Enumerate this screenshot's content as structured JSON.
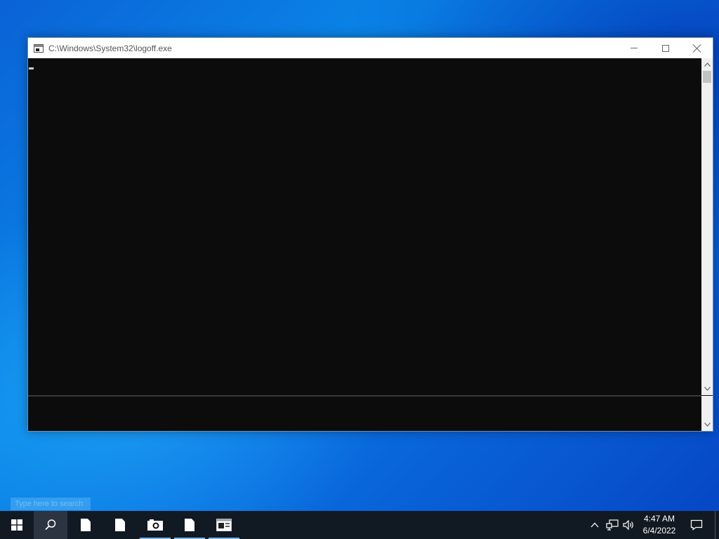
{
  "window": {
    "title": "C:\\Windows\\System32\\logoff.exe",
    "icon": "console-window-icon",
    "minimize_icon": "minimize-icon",
    "maximize_icon": "maximize-icon",
    "close_icon": "close-icon",
    "console_background": "#0c0c0c"
  },
  "desktop": {
    "search_hint": "Type here to search"
  },
  "taskbar": {
    "background": "#111923",
    "accent": "#79b6ea",
    "items": [
      {
        "name": "start-button",
        "icon": "windows-logo-icon"
      },
      {
        "name": "search-button",
        "icon": "search-icon"
      },
      {
        "name": "taskbar-app-1",
        "icon": "document-icon"
      },
      {
        "name": "taskbar-app-2",
        "icon": "document-icon"
      },
      {
        "name": "taskbar-app-3",
        "icon": "camera-icon"
      },
      {
        "name": "taskbar-app-4",
        "icon": "document-icon"
      },
      {
        "name": "taskbar-app-5",
        "icon": "console-window-icon"
      }
    ],
    "tray": {
      "chevron_icon": "chevron-up-icon",
      "network_icon": "network-icon",
      "volume_icon": "volume-icon",
      "notification_icon": "notification-icon"
    },
    "clock": {
      "time": "4:47 AM",
      "date": "6/4/2022"
    }
  }
}
